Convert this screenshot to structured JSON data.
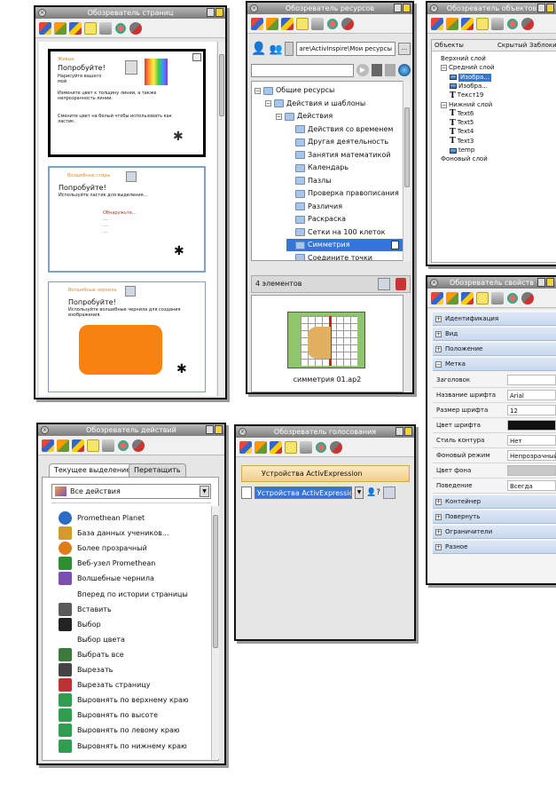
{
  "pages_panel": {
    "title": "Обозреватель страниц",
    "page1": {
      "heading": "Попробуйте!",
      "text1": "Нарисуйте вашего мой",
      "text2": "Измените цвет к толщину линии, а также непрозрачность линии.",
      "text3": "Смените цвет на белый чтобы использовать как ластик."
    },
    "page2": {
      "heading": "Попробуйте!",
      "text": "Используйте ластик для выделения...",
      "lines": [
        "Обнаружьте...",
        "....",
        "....",
        "...."
      ]
    },
    "page3": {
      "heading": "Попробуйте!",
      "text": "Используйте волшебные чернила для создания изображения."
    }
  },
  "resources_panel": {
    "title": "Обозреватель ресурсов",
    "path": "are\\ActivInspire\\Мои ресурсы",
    "browse_label": "...",
    "tree": [
      {
        "label": "Общие ресурсы",
        "level": 0
      },
      {
        "label": "Действия и шаблоны",
        "level": 1
      },
      {
        "label": "Действия",
        "level": 2
      },
      {
        "label": "Действия со временем",
        "level": 3
      },
      {
        "label": "Другая деятельность",
        "level": 3
      },
      {
        "label": "Занятия математикой",
        "level": 3
      },
      {
        "label": "Календарь",
        "level": 3
      },
      {
        "label": "Пазлы",
        "level": 3
      },
      {
        "label": "Проверка правописания",
        "level": 3
      },
      {
        "label": "Различия",
        "level": 3
      },
      {
        "label": "Раскраска",
        "level": 3
      },
      {
        "label": "Сетки на 100 клеток",
        "level": 3
      },
      {
        "label": "Симметрия",
        "level": 3,
        "selected": true
      },
      {
        "label": "Соедините точки",
        "level": 3
      }
    ],
    "count_label": "4 элементов",
    "preview_caption": "симметрия 01.ap2"
  },
  "objects_panel": {
    "title": "Обозреватель объектов",
    "columns": [
      "Объекты",
      "Скрытый",
      "Заблоки"
    ],
    "items": [
      {
        "label": "Верхний слой",
        "level": 0,
        "icon": "none"
      },
      {
        "label": "Средний слой",
        "level": 0,
        "icon": "expand"
      },
      {
        "label": "Изобра...",
        "level": 1,
        "icon": "image-icon",
        "selected": true
      },
      {
        "label": "Изобра...",
        "level": 1,
        "icon": "image-icon"
      },
      {
        "label": "Текст19",
        "level": 1,
        "icon": "text-icon"
      },
      {
        "label": "Нижний слой",
        "level": 0,
        "icon": "expand"
      },
      {
        "label": "Text6",
        "level": 1,
        "icon": "text-icon"
      },
      {
        "label": "Text5",
        "level": 1,
        "icon": "text-icon"
      },
      {
        "label": "Text4",
        "level": 1,
        "icon": "text-icon"
      },
      {
        "label": "Text3",
        "level": 1,
        "icon": "text-icon"
      },
      {
        "label": "temp",
        "level": 1,
        "icon": "image-icon"
      },
      {
        "label": "Фоновый слой",
        "level": 0,
        "icon": "none"
      }
    ]
  },
  "properties_panel": {
    "title": "Обозреватель свойств",
    "categories_top": [
      "Идентификация",
      "Вид",
      "Положение",
      "Метка"
    ],
    "rows": [
      {
        "name": "Заголовок",
        "value": ""
      },
      {
        "name": "Название шрифта",
        "value": "Arial"
      },
      {
        "name": "Размер шрифта",
        "value": "12"
      },
      {
        "name": "Цвет шрифта",
        "value": "",
        "color": "#111111"
      },
      {
        "name": "Стиль контура",
        "value": "Нет"
      },
      {
        "name": "Фоновый режим",
        "value": "Непрозрачный"
      },
      {
        "name": "Цвет фона",
        "value": "",
        "color": "#c8c8c8"
      },
      {
        "name": "Поведение",
        "value": "Всегда включено"
      }
    ],
    "categories_bottom": [
      "Контейнер",
      "Повернуть",
      "Ограничители",
      "Разное"
    ]
  },
  "actions_panel": {
    "title": "Обозреватель действий",
    "tabs": [
      "Текущее выделение",
      "Перетащить"
    ],
    "filter_value": "Все действия",
    "items": [
      {
        "label": "Promethean Planet",
        "icon": "globe-icon",
        "color": "#2b6cc4"
      },
      {
        "label": "База данных учеников...",
        "icon": "database-icon",
        "color": "#d59b2a"
      },
      {
        "label": "Более прозрачный",
        "icon": "transparency-icon",
        "color": "#e07b1a"
      },
      {
        "label": "Веб-узел Promethean",
        "icon": "web-icon",
        "color": "#2f8f2f"
      },
      {
        "label": "Волшебные чернила",
        "icon": "magic-ink-icon",
        "color": "#7a4fb0"
      },
      {
        "label": "Вперед по истории страницы",
        "icon": "none",
        "color": ""
      },
      {
        "label": "Вставить",
        "icon": "paste-icon",
        "color": "#5a5a5a"
      },
      {
        "label": "Выбор",
        "icon": "cursor-icon",
        "color": "#222222"
      },
      {
        "label": "Выбор цвета",
        "icon": "none",
        "color": ""
      },
      {
        "label": "Выбрать все",
        "icon": "select-all-icon",
        "color": "#3b7a3b"
      },
      {
        "label": "Вырезать",
        "icon": "scissors-icon",
        "color": "#444444"
      },
      {
        "label": "Вырезать страницу",
        "icon": "cut-page-icon",
        "color": "#b33"
      },
      {
        "label": "Выровнять по верхнему краю",
        "icon": "align-top-icon",
        "color": "#2f9e4f"
      },
      {
        "label": "Выровнять по высоте",
        "icon": "align-height-icon",
        "color": "#2f9e4f"
      },
      {
        "label": "Выровнять по левому краю",
        "icon": "align-left-icon",
        "color": "#2f9e4f"
      },
      {
        "label": "Выровнять по нижнему краю",
        "icon": "align-bottom-icon",
        "color": "#2f9e4f"
      }
    ]
  },
  "voting_panel": {
    "title": "Обозреватель голосования",
    "header": "Устройства ActivExpression",
    "select_value": "Устройства ActivExpression"
  }
}
